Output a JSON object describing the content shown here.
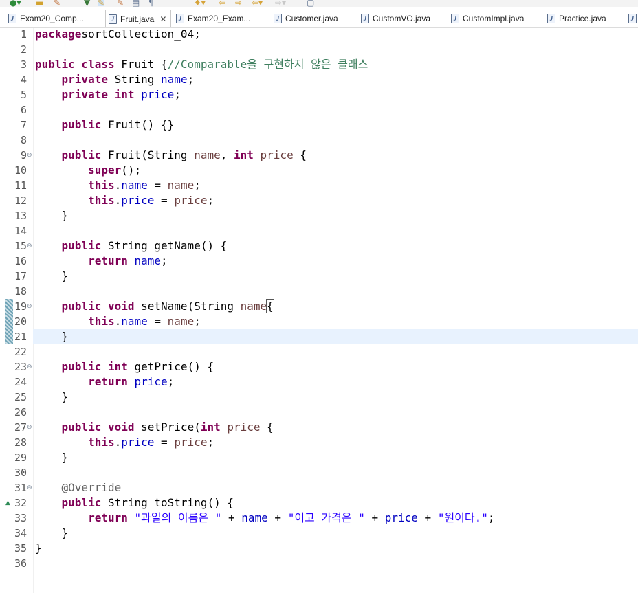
{
  "tabs": [
    {
      "label": "Exam20_Comp...",
      "active": false
    },
    {
      "label": "Fruit.java",
      "active": true
    },
    {
      "label": "Exam20_Exam...",
      "active": false
    },
    {
      "label": "Customer.java",
      "active": false
    },
    {
      "label": "CustomVO.java",
      "active": false
    },
    {
      "label": "CustomImpl.java",
      "active": false
    },
    {
      "label": "Practice.java",
      "active": false
    }
  ],
  "editor": {
    "highlighted_line": 21,
    "lines": [
      {
        "n": "1",
        "tokens": [
          [
            "kw",
            "package"
          ],
          [
            "",
            "sortCollection_04;"
          ]
        ]
      },
      {
        "n": "2",
        "tokens": []
      },
      {
        "n": "3",
        "tokens": [
          [
            "kw",
            "public class"
          ],
          [
            "",
            " Fruit {"
          ],
          [
            "cm",
            "//Comparable을 구현하지 않은 클래스"
          ]
        ]
      },
      {
        "n": "4",
        "tokens": [
          [
            "",
            "    "
          ],
          [
            "kw",
            "private"
          ],
          [
            "",
            " String "
          ],
          [
            "fld",
            "name"
          ],
          [
            "",
            ";"
          ]
        ]
      },
      {
        "n": "5",
        "tokens": [
          [
            "",
            "    "
          ],
          [
            "kw",
            "private int"
          ],
          [
            "",
            " "
          ],
          [
            "fld",
            "price"
          ],
          [
            "",
            ";"
          ]
        ]
      },
      {
        "n": "6",
        "tokens": []
      },
      {
        "n": "7",
        "tokens": [
          [
            "",
            "    "
          ],
          [
            "kw",
            "public"
          ],
          [
            "",
            " Fruit() {}"
          ]
        ]
      },
      {
        "n": "8",
        "tokens": []
      },
      {
        "n": "9",
        "fold": true,
        "tokens": [
          [
            "",
            "    "
          ],
          [
            "kw",
            "public"
          ],
          [
            "",
            " Fruit(String "
          ],
          [
            "loc",
            "name"
          ],
          [
            "",
            ", "
          ],
          [
            "kw",
            "int"
          ],
          [
            "",
            " "
          ],
          [
            "loc",
            "price"
          ],
          [
            "",
            " {"
          ]
        ]
      },
      {
        "n": "10",
        "tokens": [
          [
            "",
            "        "
          ],
          [
            "kw",
            "super"
          ],
          [
            "",
            "();"
          ]
        ]
      },
      {
        "n": "11",
        "tokens": [
          [
            "",
            "        "
          ],
          [
            "kw",
            "this"
          ],
          [
            "",
            "."
          ],
          [
            "fld",
            "name"
          ],
          [
            "",
            " = "
          ],
          [
            "loc",
            "name"
          ],
          [
            "",
            ";"
          ]
        ]
      },
      {
        "n": "12",
        "tokens": [
          [
            "",
            "        "
          ],
          [
            "kw",
            "this"
          ],
          [
            "",
            "."
          ],
          [
            "fld",
            "price"
          ],
          [
            "",
            " = "
          ],
          [
            "loc",
            "price"
          ],
          [
            "",
            ";"
          ]
        ]
      },
      {
        "n": "13",
        "tokens": [
          [
            "",
            "    }"
          ]
        ]
      },
      {
        "n": "14",
        "tokens": []
      },
      {
        "n": "15",
        "fold": true,
        "tokens": [
          [
            "",
            "    "
          ],
          [
            "kw",
            "public"
          ],
          [
            "",
            " String getName() {"
          ]
        ]
      },
      {
        "n": "16",
        "tokens": [
          [
            "",
            "        "
          ],
          [
            "kw",
            "return"
          ],
          [
            "",
            " "
          ],
          [
            "fld",
            "name"
          ],
          [
            "",
            ";"
          ]
        ]
      },
      {
        "n": "17",
        "tokens": [
          [
            "",
            "    }"
          ]
        ]
      },
      {
        "n": "18",
        "tokens": []
      },
      {
        "n": "19",
        "fold": true,
        "mark": true,
        "tokens": [
          [
            "",
            "    "
          ],
          [
            "kw",
            "public void"
          ],
          [
            "",
            " setName(String "
          ],
          [
            "loc",
            "name"
          ],
          [
            ") "
          ],
          [
            "brk",
            "{"
          ]
        ]
      },
      {
        "n": "20",
        "mark": true,
        "tokens": [
          [
            "",
            "        "
          ],
          [
            "kw",
            "this"
          ],
          [
            "",
            "."
          ],
          [
            "fld",
            "name"
          ],
          [
            "",
            " = "
          ],
          [
            "loc",
            "name"
          ],
          [
            "",
            ";"
          ]
        ]
      },
      {
        "n": "21",
        "mark": true,
        "tokens": [
          [
            "",
            "    }"
          ]
        ]
      },
      {
        "n": "22",
        "tokens": []
      },
      {
        "n": "23",
        "fold": true,
        "tokens": [
          [
            "",
            "    "
          ],
          [
            "kw",
            "public int"
          ],
          [
            "",
            " getPrice() {"
          ]
        ]
      },
      {
        "n": "24",
        "tokens": [
          [
            "",
            "        "
          ],
          [
            "kw",
            "return"
          ],
          [
            "",
            " "
          ],
          [
            "fld",
            "price"
          ],
          [
            "",
            ";"
          ]
        ]
      },
      {
        "n": "25",
        "tokens": [
          [
            "",
            "    }"
          ]
        ]
      },
      {
        "n": "26",
        "tokens": []
      },
      {
        "n": "27",
        "fold": true,
        "tokens": [
          [
            "",
            "    "
          ],
          [
            "kw",
            "public void"
          ],
          [
            "",
            " setPrice("
          ],
          [
            "kw",
            "int"
          ],
          [
            "",
            " "
          ],
          [
            "loc",
            "price"
          ],
          [
            "",
            " {"
          ]
        ]
      },
      {
        "n": "28",
        "tokens": [
          [
            "",
            "        "
          ],
          [
            "kw",
            "this"
          ],
          [
            "",
            "."
          ],
          [
            "fld",
            "price"
          ],
          [
            "",
            " = "
          ],
          [
            "loc",
            "price"
          ],
          [
            "",
            ";"
          ]
        ]
      },
      {
        "n": "29",
        "tokens": [
          [
            "",
            "    }"
          ]
        ]
      },
      {
        "n": "30",
        "tokens": []
      },
      {
        "n": "31",
        "fold": true,
        "tokens": [
          [
            "",
            "    "
          ],
          [
            "ann",
            "@Override"
          ]
        ]
      },
      {
        "n": "32",
        "override": true,
        "tokens": [
          [
            "",
            "    "
          ],
          [
            "kw",
            "public"
          ],
          [
            "",
            " String toString() {"
          ]
        ]
      },
      {
        "n": "33",
        "tokens": [
          [
            "",
            "        "
          ],
          [
            "kw",
            "return"
          ],
          [
            "",
            " "
          ],
          [
            "str",
            "\"과일의 이름은 \""
          ],
          [
            "",
            " + "
          ],
          [
            "fld",
            "name"
          ],
          [
            "",
            " + "
          ],
          [
            "str",
            "\"이고 가격은 \""
          ],
          [
            "",
            " + "
          ],
          [
            "fld",
            "price"
          ],
          [
            "",
            " + "
          ],
          [
            "str",
            "\"원이다.\""
          ],
          [
            "",
            ";"
          ]
        ]
      },
      {
        "n": "34",
        "tokens": [
          [
            "",
            "    }"
          ]
        ]
      },
      {
        "n": "35",
        "tokens": [
          [
            "",
            "}"
          ]
        ]
      },
      {
        "n": "36",
        "tokens": []
      }
    ]
  },
  "icons": {
    "file": "java-file-icon",
    "fold": "collapse-minus-icon",
    "override": "override-triangle-icon"
  },
  "colors": {
    "keyword": "#7f0055",
    "field": "#0000c0",
    "local": "#6a3e3e",
    "string": "#2a00ff",
    "comment": "#3f7f5f",
    "annotation": "#646464",
    "highlight": "#e8f2fe"
  }
}
